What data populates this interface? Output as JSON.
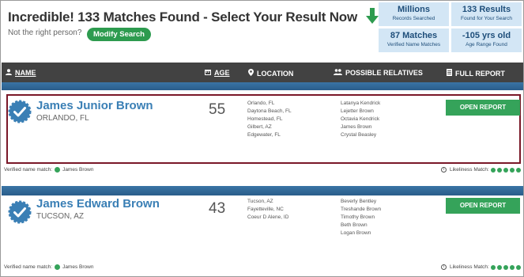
{
  "header": {
    "headline": "Incredible! 133 Matches Found - Select Your Result Now",
    "not_right": "Not the right person?",
    "modify_label": "Modify Search"
  },
  "stats": [
    {
      "value": "Millions",
      "label": "Records Searched"
    },
    {
      "value": "133 Results",
      "label": "Found for Your Search"
    },
    {
      "value": "87 Matches",
      "label": "Verified Name Matches"
    },
    {
      "value": "-105 yrs old",
      "label": "Age Range Found"
    }
  ],
  "table_header": {
    "name": "NAME",
    "age": "AGE",
    "location": "LOCATION",
    "relatives": "POSSIBLE RELATIVES",
    "report": "FULL REPORT"
  },
  "results": [
    {
      "name": "James Junior Brown",
      "city": "ORLANDO, FL",
      "age": "55",
      "locations": [
        "Orlando, FL",
        "Daytona Beach, FL",
        "Homestead, FL",
        "Gilbert, AZ",
        "Edgewater, FL"
      ],
      "relatives": [
        "Latanya Kendrick",
        "Lejetter Brown",
        "Octavia Kendrick",
        "James Brown",
        "Crystal Beasley"
      ],
      "button": "OPEN REPORT",
      "verified_label": "Verified name match:",
      "verified_name": "James Brown",
      "likeliness_label": "Likeliness Match:",
      "likeliness": 5
    },
    {
      "name": "James Edward Brown",
      "city": "TUCSON, AZ",
      "age": "43",
      "locations": [
        "Tucson, AZ",
        "Fayetteville, NC",
        "Coeur D Alene, ID"
      ],
      "relatives": [
        "Beverly Bentley",
        "Treshande Brown",
        "Timothy Brown",
        "Beth Brown",
        "Logan Brown"
      ],
      "button": "OPEN REPORT",
      "verified_label": "Verified name match:",
      "verified_name": "James Brown",
      "likeliness_label": "Likeliness Match:",
      "likeliness": 5
    }
  ],
  "colors": {
    "accent_green": "#35a35a",
    "name_blue": "#3a7fb5",
    "header_dark": "#424242",
    "stripe_blue": "#2f6a99",
    "selected_border": "#7a1828",
    "stat_bg": "#d3e6f5"
  },
  "icons": {
    "arrow": "down-arrow-icon",
    "name": "person-icon",
    "age": "calendar-icon",
    "location": "map-pin-icon",
    "relatives": "people-icon",
    "report": "document-icon",
    "verified": "verified-badge-icon"
  }
}
